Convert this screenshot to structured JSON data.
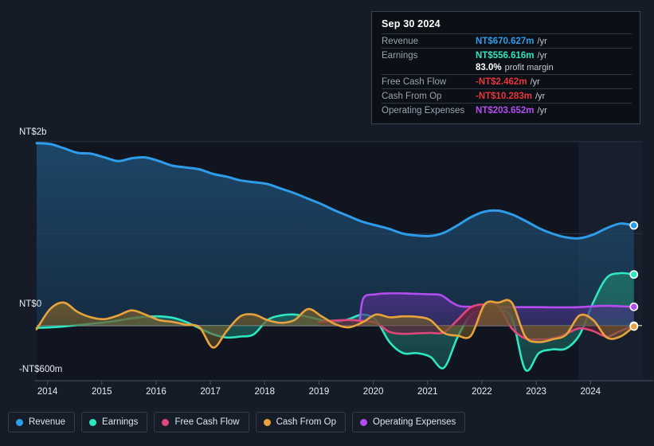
{
  "tooltip": {
    "date": "Sep 30 2024",
    "rows": [
      {
        "label": "Revenue",
        "value": "NT$670.627m",
        "suffix": "/yr",
        "color": "#2e9ce8"
      },
      {
        "label": "Earnings",
        "value": "NT$556.616m",
        "suffix": "/yr",
        "color": "#2ee6c0"
      },
      {
        "label": "",
        "value": "83.0%",
        "suffix": "profit margin",
        "color": "#ffffff"
      },
      {
        "label": "Free Cash Flow",
        "value": "-NT$2.462m",
        "suffix": "/yr",
        "color": "#e8343c"
      },
      {
        "label": "Cash From Op",
        "value": "-NT$10.283m",
        "suffix": "/yr",
        "color": "#e8343c"
      },
      {
        "label": "Operating Expenses",
        "value": "NT$203.652m",
        "suffix": "/yr",
        "color": "#b44df0"
      }
    ]
  },
  "legend": [
    {
      "label": "Revenue",
      "color": "#2e9ce8"
    },
    {
      "label": "Earnings",
      "color": "#2ee6c0"
    },
    {
      "label": "Free Cash Flow",
      "color": "#e0457b"
    },
    {
      "label": "Cash From Op",
      "color": "#e8a33d"
    },
    {
      "label": "Operating Expenses",
      "color": "#b44df0"
    }
  ],
  "chart_data": {
    "type": "area",
    "title": "",
    "xlabel": "",
    "ylabel": "",
    "currency": "NT$",
    "ylim": [
      -600000000,
      2000000000
    ],
    "y_ticks": [
      {
        "value": 2000000000,
        "label": "NT$2b"
      },
      {
        "value": 0,
        "label": "NT$0"
      },
      {
        "value": -600000000,
        "label": "-NT$600m"
      }
    ],
    "gridlines": [
      2000000000,
      1000000000,
      0
    ],
    "x_ticks": [
      "2014",
      "2015",
      "2016",
      "2017",
      "2018",
      "2019",
      "2020",
      "2021",
      "2022",
      "2023",
      "2024"
    ],
    "x_range": [
      "2013-10",
      "2024-12"
    ],
    "forecast_start": "2023-10",
    "series": [
      {
        "name": "Revenue",
        "color": "#2e9ce8",
        "fill": "#1e4a6e",
        "x": [
          2013.8,
          2014.05,
          2014.3,
          2014.55,
          2014.8,
          2015.05,
          2015.3,
          2015.55,
          2015.8,
          2016.05,
          2016.3,
          2016.55,
          2016.8,
          2017.05,
          2017.3,
          2017.55,
          2017.8,
          2018.05,
          2018.3,
          2018.55,
          2018.8,
          2019.05,
          2019.3,
          2019.55,
          2019.8,
          2020.05,
          2020.3,
          2020.55,
          2020.8,
          2021.05,
          2021.3,
          2021.55,
          2021.8,
          2022.05,
          2022.3,
          2022.55,
          2022.8,
          2023.05,
          2023.3,
          2023.55,
          2023.8,
          2024.05,
          2024.3,
          2024.55,
          2024.8
        ],
        "y": [
          1985,
          1975,
          1930,
          1880,
          1870,
          1830,
          1790,
          1820,
          1830,
          1790,
          1740,
          1720,
          1700,
          1650,
          1620,
          1580,
          1560,
          1540,
          1490,
          1440,
          1380,
          1320,
          1250,
          1190,
          1130,
          1090,
          1050,
          1000,
          980,
          975,
          1010,
          1090,
          1180,
          1240,
          1250,
          1210,
          1140,
          1060,
          1000,
          960,
          950,
          990,
          1060,
          1110,
          1090
        ],
        "unit": "NT$ millions"
      },
      {
        "name": "Earnings",
        "color": "#2ee6c0",
        "fill": "#1f6e66",
        "x": [
          2013.8,
          2014.05,
          2014.3,
          2014.55,
          2014.8,
          2015.05,
          2015.3,
          2015.55,
          2015.8,
          2016.05,
          2016.3,
          2016.55,
          2016.8,
          2017.05,
          2017.3,
          2017.55,
          2017.8,
          2018.05,
          2018.3,
          2018.55,
          2018.8,
          2019.05,
          2019.3,
          2019.55,
          2019.8,
          2020.05,
          2020.3,
          2020.55,
          2020.8,
          2021.05,
          2021.3,
          2021.55,
          2021.8,
          2022.05,
          2022.3,
          2022.55,
          2022.8,
          2023.05,
          2023.3,
          2023.55,
          2023.8,
          2024.05,
          2024.3,
          2024.55,
          2024.8
        ],
        "y": [
          -25,
          -20,
          -10,
          5,
          20,
          35,
          55,
          80,
          95,
          100,
          85,
          40,
          -30,
          -95,
          -130,
          -120,
          -95,
          60,
          110,
          120,
          95,
          60,
          40,
          70,
          120,
          60,
          -180,
          -300,
          -300,
          -340,
          -460,
          -130,
          120,
          160,
          150,
          90,
          -480,
          -300,
          -260,
          -250,
          -100,
          250,
          520,
          570,
          556
        ],
        "unit": "NT$ millions"
      },
      {
        "name": "Free Cash Flow",
        "color": "#e0457b",
        "fill": "#6e2238",
        "x": [
          2019.0,
          2019.3,
          2019.55,
          2019.8,
          2020.05,
          2020.3,
          2020.55,
          2020.8,
          2021.05,
          2021.3,
          2021.55,
          2021.8,
          2022.05,
          2022.3,
          2022.55,
          2022.8,
          2023.05,
          2023.3,
          2023.55,
          2023.8,
          2024.05,
          2024.3,
          2024.55,
          2024.8
        ],
        "y": [
          40,
          55,
          60,
          50,
          30,
          -70,
          -90,
          -85,
          -80,
          -75,
          60,
          200,
          230,
          210,
          -30,
          -140,
          -150,
          -140,
          -90,
          -30,
          -60,
          -120,
          -60,
          -2
        ],
        "unit": "NT$ millions"
      },
      {
        "name": "Cash From Op",
        "color": "#e8a33d",
        "fill": "#6e5a2c",
        "x": [
          2013.8,
          2014.05,
          2014.3,
          2014.55,
          2014.8,
          2015.05,
          2015.3,
          2015.55,
          2015.8,
          2016.05,
          2016.3,
          2016.55,
          2016.8,
          2017.05,
          2017.3,
          2017.55,
          2017.8,
          2018.05,
          2018.3,
          2018.55,
          2018.8,
          2019.05,
          2019.3,
          2019.55,
          2019.8,
          2020.05,
          2020.3,
          2020.55,
          2020.8,
          2021.05,
          2021.3,
          2021.55,
          2021.8,
          2022.05,
          2022.3,
          2022.55,
          2022.8,
          2023.05,
          2023.3,
          2023.55,
          2023.8,
          2024.05,
          2024.3,
          2024.55,
          2024.8
        ],
        "y": [
          -40,
          180,
          250,
          150,
          90,
          70,
          110,
          165,
          120,
          60,
          40,
          10,
          -20,
          -240,
          -60,
          100,
          120,
          60,
          30,
          60,
          180,
          100,
          15,
          -20,
          35,
          120,
          90,
          100,
          95,
          60,
          -80,
          -110,
          -110,
          230,
          250,
          250,
          -120,
          -180,
          -150,
          -100,
          110,
          60,
          -130,
          -120,
          -10
        ],
        "unit": "NT$ millions"
      },
      {
        "name": "Operating Expenses",
        "color": "#b44df0",
        "fill": "#4a2f82",
        "x": [
          2019.75,
          2019.82,
          2020.05,
          2020.3,
          2020.55,
          2020.8,
          2021.05,
          2021.25,
          2021.45,
          2021.6,
          2021.8,
          2022.05,
          2022.3,
          2022.55,
          2022.8,
          2023.05,
          2023.3,
          2023.55,
          2023.8,
          2024.05,
          2024.3,
          2024.55,
          2024.8
        ],
        "y": [
          40,
          300,
          340,
          350,
          350,
          345,
          340,
          330,
          250,
          210,
          205,
          205,
          200,
          200,
          200,
          200,
          198,
          198,
          200,
          210,
          215,
          210,
          204
        ],
        "unit": "NT$ millions"
      }
    ]
  }
}
